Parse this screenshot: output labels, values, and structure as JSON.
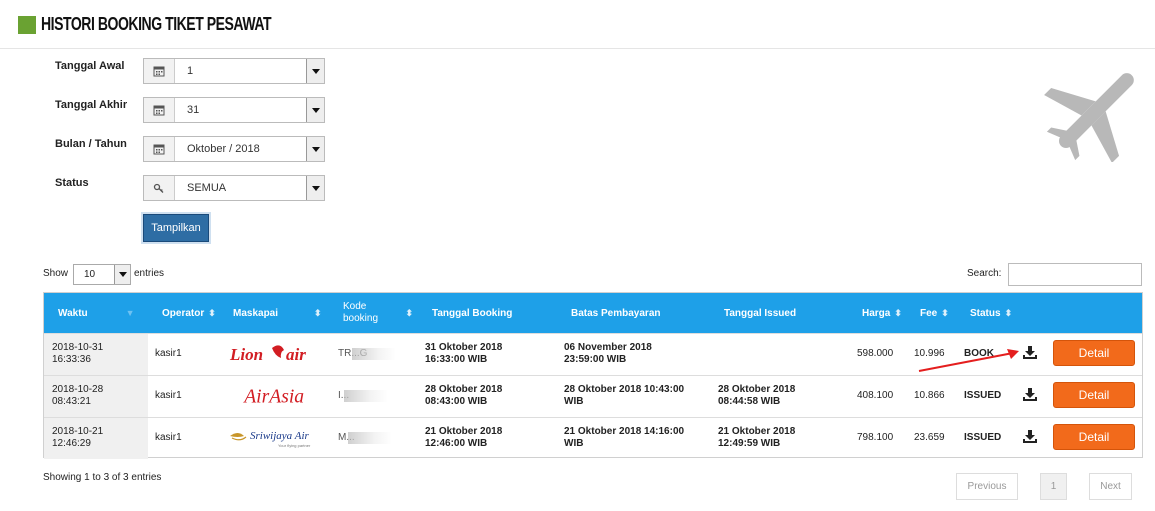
{
  "page": {
    "title": "HISTORI BOOKING TIKET PESAWAT",
    "accent_color": "#6aa232"
  },
  "filters": {
    "tanggal_awal": {
      "label": "Tanggal Awal",
      "value": "1",
      "icon": "calendar-icon"
    },
    "tanggal_akhir": {
      "label": "Tanggal Akhir",
      "value": "31",
      "icon": "calendar-icon"
    },
    "bulan_tahun": {
      "label": "Bulan / Tahun",
      "value": "Oktober / 2018",
      "icon": "calendar-icon"
    },
    "status": {
      "label": "Status",
      "value": "SEMUA",
      "icon": "key-icon"
    },
    "submit_label": "Tampilkan"
  },
  "table_controls": {
    "show_label": "Show",
    "entries_value": "10",
    "entries_label": "entries",
    "search_label": "Search:",
    "search_value": ""
  },
  "table": {
    "header_color": "#1ea0e8",
    "columns": [
      "Waktu",
      "Operator",
      "Maskapai",
      "Kode booking",
      "Tanggal Booking",
      "Batas Pembayaran",
      "Tanggal Issued",
      "Harga",
      "Fee",
      "Status"
    ],
    "rows": [
      {
        "waktu_date": "2018-10-31",
        "waktu_time": "16:33:36",
        "operator": "kasir1",
        "maskapai": "Lion Air",
        "maskapai_logo": "lion-air-logo",
        "kode": "TR...G",
        "tanggal_booking_date": "31 Oktober 2018",
        "tanggal_booking_time": "16:33:00 WIB",
        "batas_date": "06 November 2018",
        "batas_time": "23:59:00 WIB",
        "issued_date": "",
        "issued_time": "",
        "harga": "598.000",
        "fee": "10.996",
        "status": "BOOK",
        "detail_label": "Detail"
      },
      {
        "waktu_date": "2018-10-28",
        "waktu_time": "08:43:21",
        "operator": "kasir1",
        "maskapai": "AirAsia",
        "maskapai_logo": "airasia-logo",
        "kode": "I...",
        "tanggal_booking_date": "28 Oktober 2018",
        "tanggal_booking_time": "08:43:00 WIB",
        "batas_date": "28 Oktober 2018 10:43:00",
        "batas_time": "WIB",
        "issued_date": "28 Oktober 2018",
        "issued_time": "08:44:58 WIB",
        "harga": "408.100",
        "fee": "10.866",
        "status": "ISSUED",
        "detail_label": "Detail"
      },
      {
        "waktu_date": "2018-10-21",
        "waktu_time": "12:46:29",
        "operator": "kasir1",
        "maskapai": "Sriwijaya Air",
        "maskapai_logo": "sriwijaya-air-logo",
        "kode": "M...",
        "tanggal_booking_date": "21 Oktober 2018",
        "tanggal_booking_time": "12:46:00 WIB",
        "batas_date": "21 Oktober 2018 14:16:00",
        "batas_time": "WIB",
        "issued_date": "21 Oktober 2018",
        "issued_time": "12:49:59 WIB",
        "harga": "798.100",
        "fee": "23.659",
        "status": "ISSUED",
        "detail_label": "Detail"
      }
    ],
    "detail_button_color": "#f26a1b"
  },
  "footer": {
    "showing": "Showing 1 to 3 of 3 entries",
    "previous": "Previous",
    "page": "1",
    "next": "Next"
  }
}
